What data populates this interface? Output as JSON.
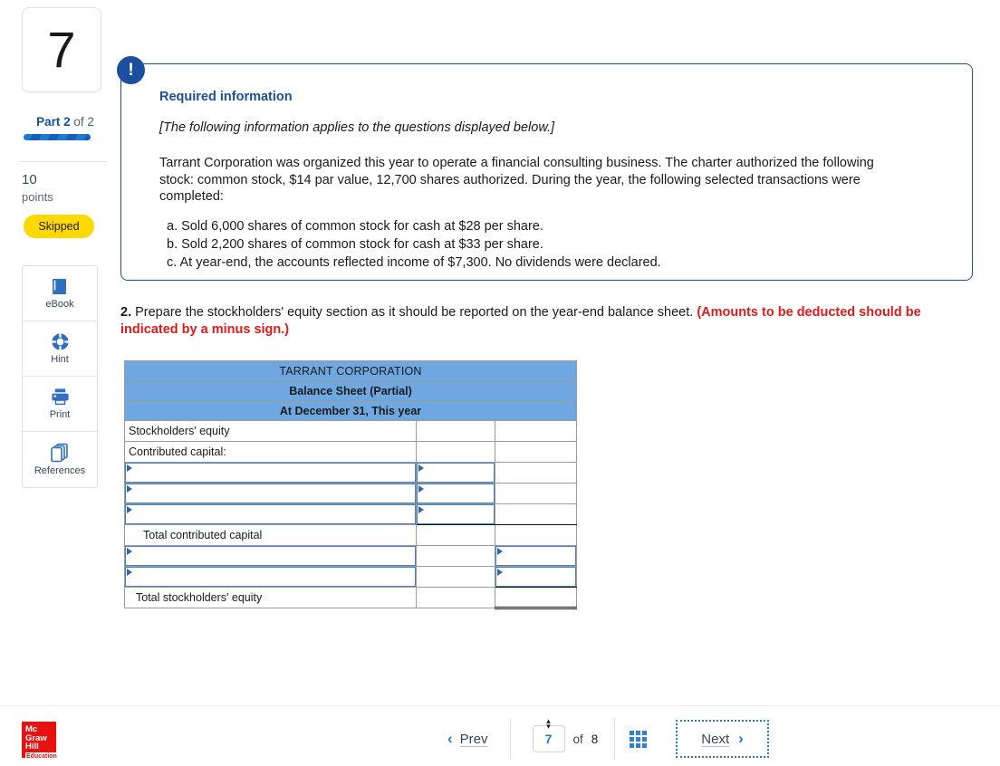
{
  "sidebar": {
    "question_number": "7",
    "part_label_prefix": "Part",
    "part_current": "2",
    "part_suffix": "of 2",
    "points_value": "10",
    "points_word": "points",
    "status_badge": "Skipped",
    "tools": [
      {
        "label": "eBook",
        "icon": "book-icon"
      },
      {
        "label": "Hint",
        "icon": "lifebuoy-icon"
      },
      {
        "label": "Print",
        "icon": "printer-icon"
      },
      {
        "label": "References",
        "icon": "copy-pages-icon"
      }
    ]
  },
  "info": {
    "badge_icon": "exclamation-icon",
    "title": "Required information",
    "applies_note": "[The following information applies to the questions displayed below.]",
    "paragraph": "Tarrant Corporation was organized this year to operate a financial consulting business. The charter authorized the following stock: common stock, $14 par value, 12,700 shares authorized. During the year, the following selected transactions were completed:",
    "transactions": [
      "a. Sold 6,000 shares of common stock for cash at $28 per share.",
      "b. Sold 2,200 shares of common stock for cash at $33 per share.",
      "c. At year-end, the accounts reflected income of $7,300. No dividends were declared."
    ]
  },
  "question": {
    "number": "2.",
    "text": " Prepare the stockholders' equity section as it should be reported on the year-end balance sheet. ",
    "warning": "(Amounts to be deducted should be indicated by a minus sign.)"
  },
  "worksheet": {
    "header_lines": [
      "TARRANT CORPORATION",
      "Balance Sheet (Partial)",
      "At December 31, This year"
    ],
    "rows": [
      {
        "label": "Stockholders' equity",
        "indent": 0,
        "mid": "",
        "right": "",
        "mid_input": false,
        "right_input": false,
        "label_input": false
      },
      {
        "label": "Contributed capital:",
        "indent": 0,
        "mid": "",
        "right": "",
        "mid_input": false,
        "right_input": false,
        "label_input": false
      },
      {
        "label": "",
        "indent": 0,
        "mid": "",
        "right": "",
        "mid_input": true,
        "right_input": false,
        "label_input": true
      },
      {
        "label": "",
        "indent": 0,
        "mid": "",
        "right": "",
        "mid_input": true,
        "right_input": false,
        "label_input": true
      },
      {
        "label": "",
        "indent": 0,
        "mid": "",
        "right": "",
        "mid_input": true,
        "right_input": false,
        "label_input": true
      },
      {
        "label": "Total contributed capital",
        "indent": 2,
        "mid": "",
        "right": "",
        "mid_input": false,
        "right_input": false,
        "label_input": false
      },
      {
        "label": "",
        "indent": 0,
        "mid": "",
        "right": "",
        "mid_input": false,
        "right_input": true,
        "label_input": true
      },
      {
        "label": "",
        "indent": 0,
        "mid": "",
        "right": "",
        "mid_input": false,
        "right_input": true,
        "label_input": true
      },
      {
        "label": "Total stockholders' equity",
        "indent": 1,
        "mid": "",
        "right": "",
        "mid_input": false,
        "right_input": false,
        "label_input": false
      }
    ]
  },
  "footer": {
    "logo_lines": [
      "Mc",
      "Graw",
      "Hill"
    ],
    "logo_sub": "Education",
    "prev_label": "Prev",
    "next_label": "Next",
    "page_value": "7",
    "of_word": "of",
    "page_total": "8",
    "grid_icon": "grid-icon"
  },
  "colors": {
    "accent_blue": "#1f7ad4",
    "deep_blue": "#1b4fa0",
    "table_header_blue": "#6fa8e0",
    "badge_yellow": "#fdd900",
    "warning_red": "#e01b1b",
    "logo_red": "#e8110f"
  }
}
